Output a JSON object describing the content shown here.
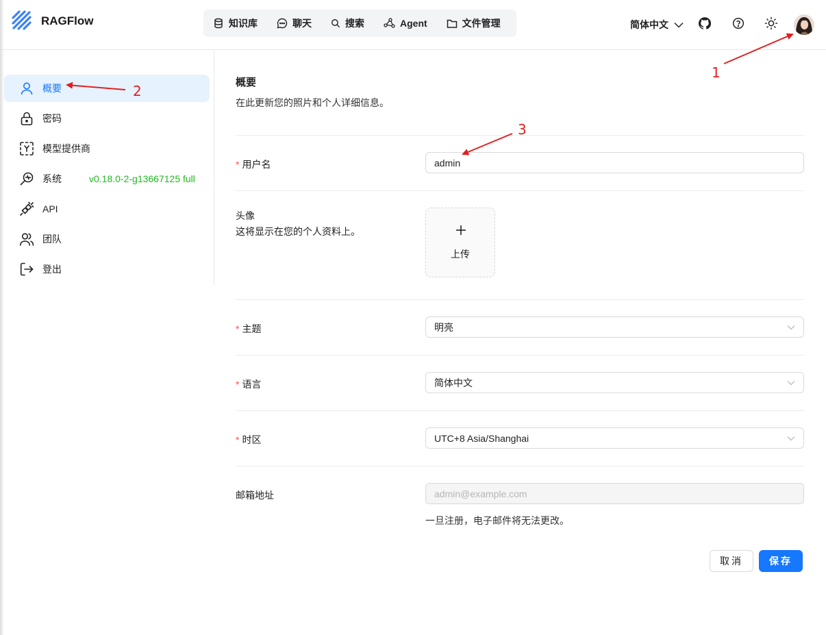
{
  "header": {
    "brand": "RAGFlow",
    "nav": [
      {
        "label": "知识库",
        "icon": "database-icon"
      },
      {
        "label": "聊天",
        "icon": "chat-icon"
      },
      {
        "label": "搜索",
        "icon": "search-icon"
      },
      {
        "label": "Agent",
        "icon": "agent-graph-icon"
      },
      {
        "label": "文件管理",
        "icon": "folder-icon"
      }
    ],
    "language": "简体中文",
    "icons": [
      "github-icon",
      "help-icon",
      "theme-sun-icon",
      "avatar"
    ]
  },
  "sidebar": {
    "items": [
      {
        "label": "概要",
        "icon": "user-icon",
        "active": true
      },
      {
        "label": "密码",
        "icon": "lock-icon"
      },
      {
        "label": "模型提供商",
        "icon": "model-provider-icon"
      },
      {
        "label": "系统",
        "icon": "system-search-icon"
      },
      {
        "label": "API",
        "icon": "plug-icon"
      },
      {
        "label": "团队",
        "icon": "team-icon"
      },
      {
        "label": "登出",
        "icon": "logout-icon"
      }
    ],
    "version": "v0.18.0-2-g13667125 full"
  },
  "main": {
    "title": "概要",
    "description": "在此更新您的照片和个人详细信息。",
    "username": {
      "label": "用户名",
      "required_mark": "*",
      "value": "admin"
    },
    "avatar": {
      "label": "头像",
      "sublabel": "这将显示在您的个人资料上。",
      "upload_label": "上传"
    },
    "theme": {
      "label": "主题",
      "required_mark": "*",
      "value": "明亮"
    },
    "language": {
      "label": "语言",
      "required_mark": "*",
      "value": "简体中文"
    },
    "timezone": {
      "label": "时区",
      "required_mark": "*",
      "value": "UTC+8 Asia/Shanghai"
    },
    "email": {
      "label": "邮箱地址",
      "placeholder": "admin@example.com",
      "hint": "一旦注册，电子邮件将无法更改。"
    },
    "cancel_label": "取消",
    "save_label": "保存"
  },
  "annotations": [
    "1",
    "2",
    "3"
  ],
  "colors": {
    "accent": "#1677ff",
    "version": "#22b822",
    "required": "#ff4d4f",
    "annotation": "#e02020"
  }
}
